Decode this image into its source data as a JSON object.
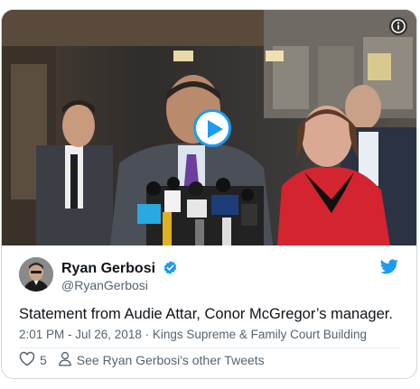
{
  "tweet": {
    "display_name": "Ryan Gerbosi",
    "handle": "@RyanGerbosi",
    "text": "Statement from Audie Attar, Conor McGregor’s manager.",
    "time": "2:01 PM - Jul 26, 2018",
    "separator": "·",
    "location": "Kings Supreme & Family Court Building",
    "like_count": "5",
    "other_tweets_label": "See Ryan Gerbosi's other Tweets"
  },
  "icons": {
    "info": "info-icon",
    "play": "play-icon",
    "verified": "verified-badge-icon",
    "bird": "twitter-bird-icon",
    "heart": "heart-icon",
    "person": "person-icon"
  },
  "colors": {
    "accent": "#1d9bf0",
    "text": "#0f1419",
    "muted": "#536471"
  }
}
